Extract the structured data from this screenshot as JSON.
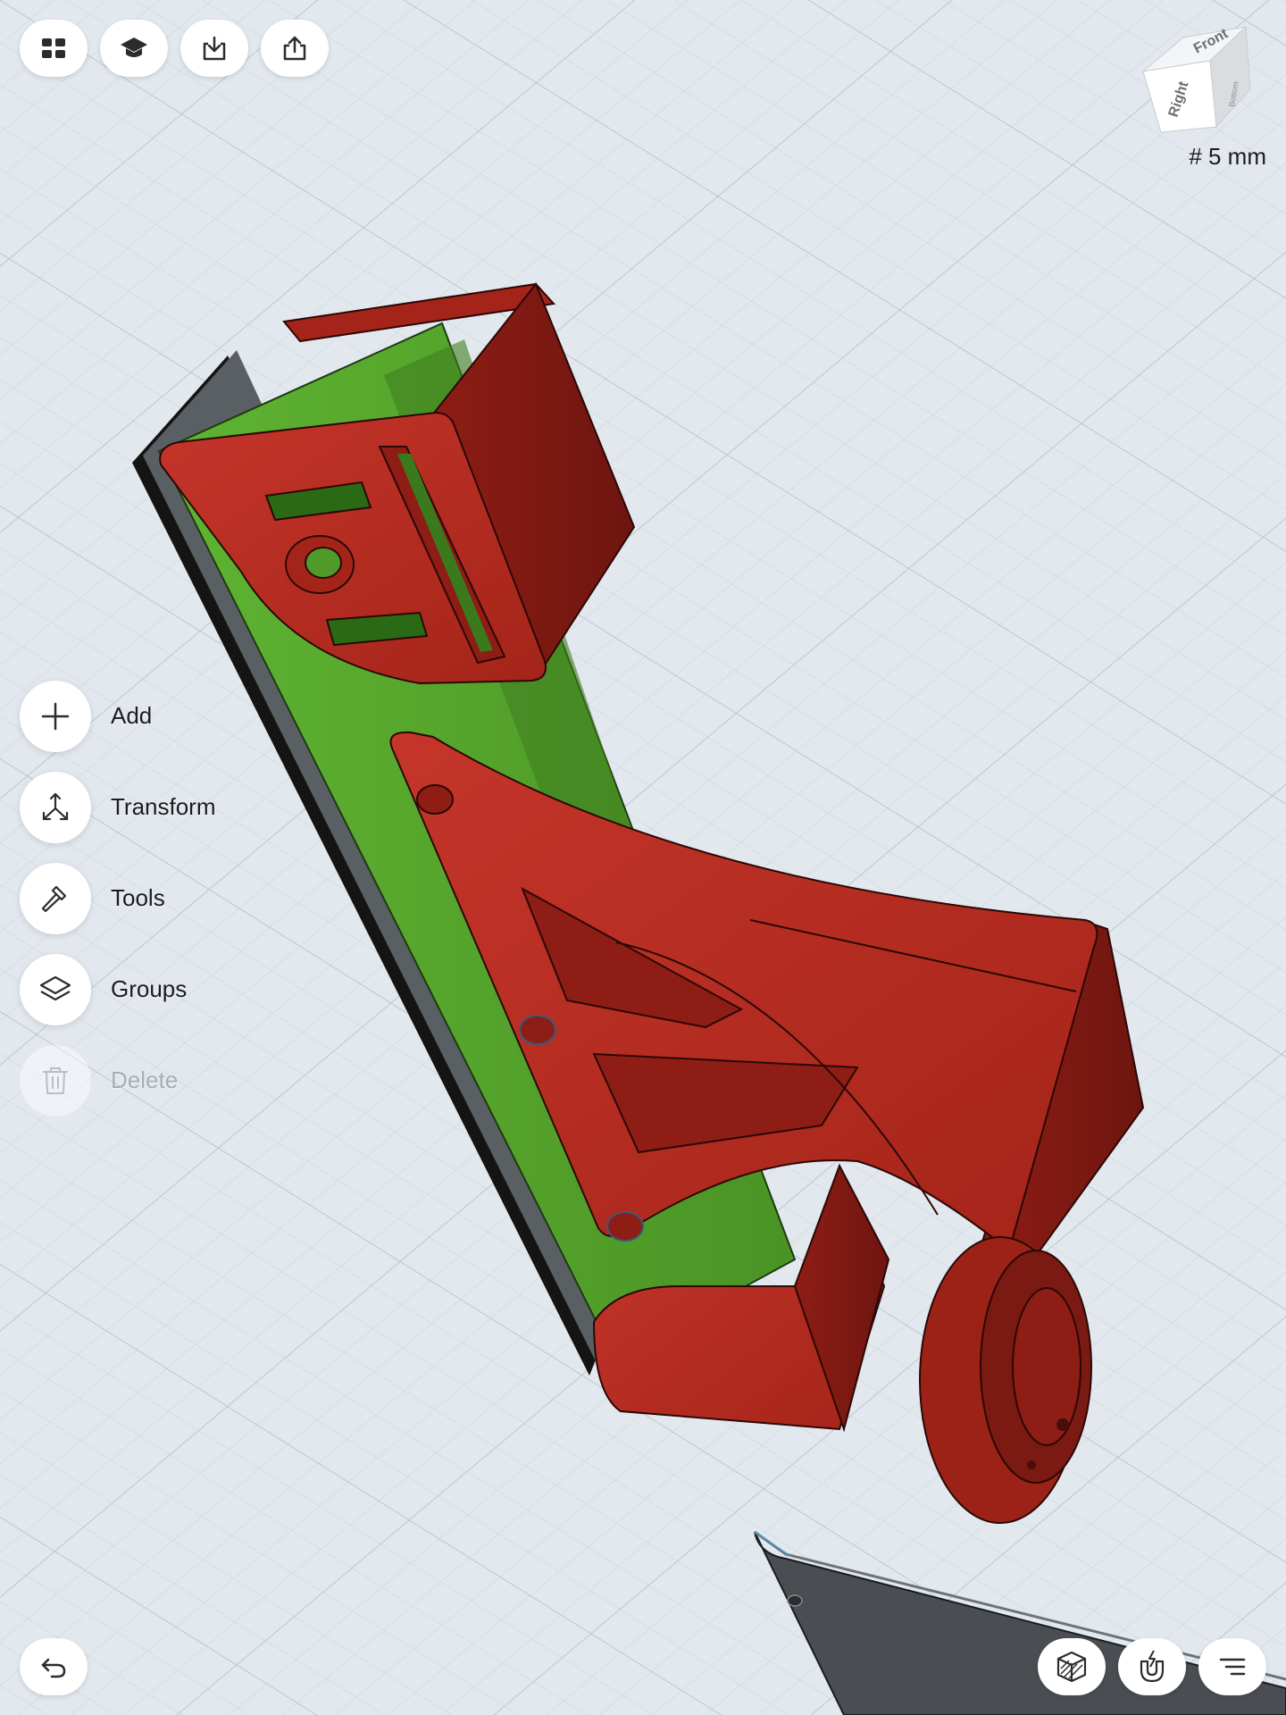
{
  "toolbar": {
    "icons": [
      "apps-icon",
      "learn-icon",
      "import-icon",
      "share-icon"
    ]
  },
  "view_cube": {
    "front_label": "Front",
    "right_label": "Right",
    "bottom_label": "Bottom"
  },
  "grid": {
    "readout": "# 5 mm"
  },
  "side_menu": {
    "items": [
      {
        "label": "Add",
        "icon": "plus-icon",
        "enabled": true
      },
      {
        "label": "Transform",
        "icon": "transform-icon",
        "enabled": true
      },
      {
        "label": "Tools",
        "icon": "hammer-icon",
        "enabled": true
      },
      {
        "label": "Groups",
        "icon": "layers-icon",
        "enabled": true
      },
      {
        "label": "Delete",
        "icon": "trash-icon",
        "enabled": false
      }
    ]
  },
  "bottom_bar": {
    "icons": [
      "undo-icon",
      "view-mode-icon",
      "snap-magnet-icon",
      "menu-icon"
    ]
  },
  "colors": {
    "background": "#e2e8ee",
    "part_red": "#b8291f",
    "part_green": "#56a82e",
    "part_gray": "#4a4e52"
  }
}
